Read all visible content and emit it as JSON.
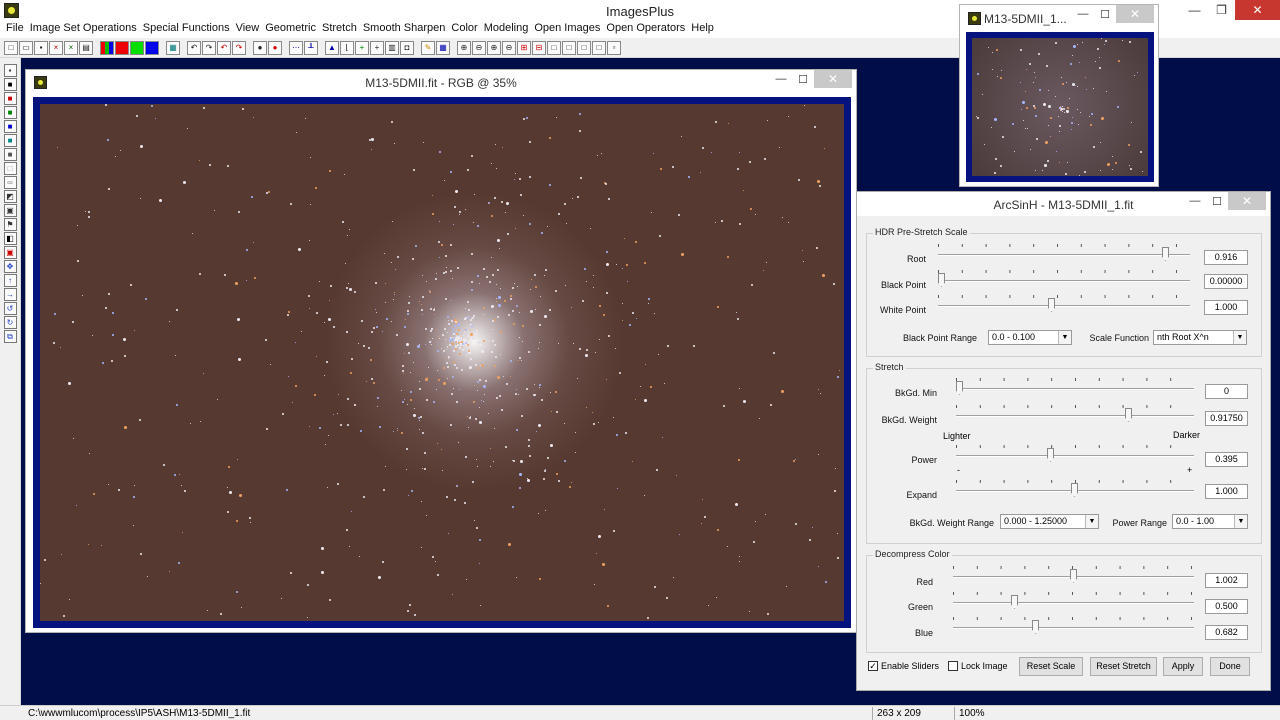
{
  "app": {
    "title": "ImagesPlus",
    "controls": {
      "minimize": "—",
      "maximize": "❐",
      "close": "✕"
    }
  },
  "menu": [
    "File",
    "Image Set Operations",
    "Special Functions",
    "View",
    "Geometric",
    "Stretch",
    "Smooth Sharpen",
    "Color",
    "Modeling",
    "Open Images",
    "Open Operators",
    "Help"
  ],
  "main_window": {
    "title": "M13-5DMII.fit - RGB @ 35%",
    "controls": {
      "minimize": "—",
      "maximize": "☐",
      "close": "✕"
    }
  },
  "thumb_window": {
    "title": "M13-5DMII_1...",
    "controls": {
      "minimize": "—",
      "maximize": "☐",
      "close": "✕"
    }
  },
  "dialog": {
    "title": "ArcSinH - M13-5DMII_1.fit",
    "controls": {
      "minimize": "—",
      "maximize": "☐",
      "close": "✕"
    },
    "hdr": {
      "label": "HDR Pre-Stretch Scale",
      "root_label": "Root",
      "root_value": "0.916",
      "root_pos": 0.916,
      "black_label": "Black Point",
      "black_value": "0.00000",
      "black_pos": 0.0,
      "white_label": "White Point",
      "white_value": "1.000",
      "white_pos": 0.45,
      "bp_range_label": "Black Point Range",
      "bp_range_value": "0.0 - 0.100",
      "scale_fn_label": "Scale Function",
      "scale_fn_value": "nth Root X^n"
    },
    "stretch": {
      "label": "Stretch",
      "bkmin_label": "BkGd. Min",
      "bkmin_value": "0",
      "bkmin_pos": 0.0,
      "bkweight_label": "BkGd. Weight",
      "bkweight_value": "0.91750",
      "bkweight_pos": 0.734,
      "lighter": "Lighter",
      "darker": "Darker",
      "power_label": "Power",
      "power_value": "0.395",
      "power_pos": 0.395,
      "minus": "-",
      "plus": "+",
      "expand_label": "Expand",
      "expand_value": "1.000",
      "expand_pos": 0.5,
      "bkw_range_label": "BkGd. Weight Range",
      "bkw_range_value": "0.000 - 1.25000",
      "power_range_label": "Power Range",
      "power_range_value": "0.0 - 1.00"
    },
    "decompress": {
      "label": "Decompress Color",
      "red_label": "Red",
      "red_value": "1.002",
      "red_pos": 0.501,
      "green_label": "Green",
      "green_value": "0.500",
      "green_pos": 0.25,
      "blue_label": "Blue",
      "blue_value": "0.682",
      "blue_pos": 0.341
    },
    "enable_sliders": "Enable Sliders",
    "enable_sliders_checked": true,
    "lock_image": "Lock Image",
    "lock_image_checked": false,
    "reset_scale": "Reset Scale",
    "reset_stretch": "Reset Stretch",
    "apply": "Apply",
    "done": "Done"
  },
  "status": {
    "path": "C:\\wwwmlucom\\process\\IP5\\ASH\\M13-5DMII_1.fit",
    "dims": "263 x 209",
    "zoom": "100%"
  }
}
